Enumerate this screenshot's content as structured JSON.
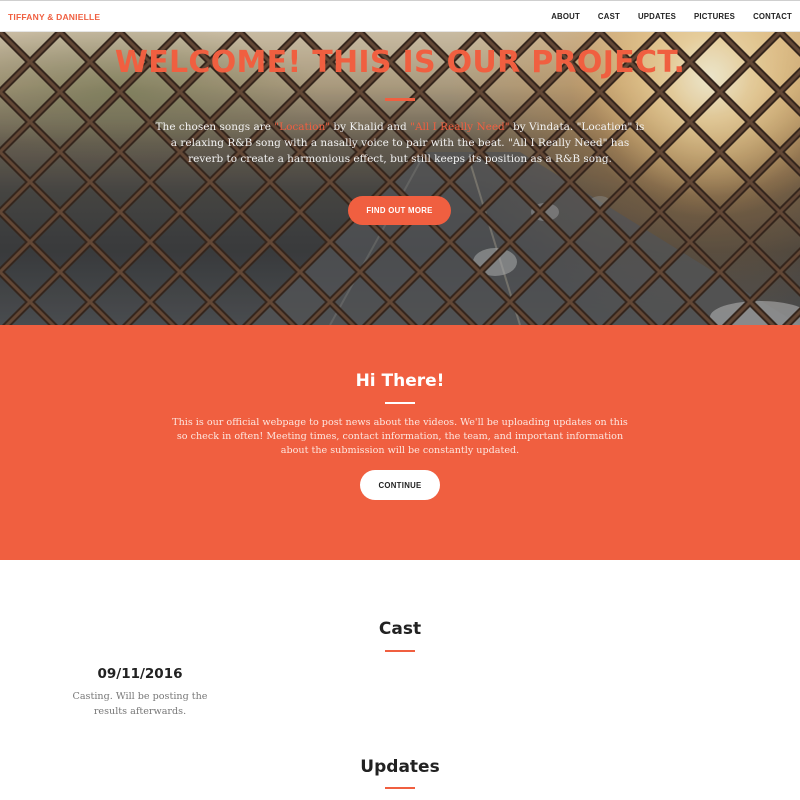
{
  "nav": {
    "brand": "TIFFANY & DANIELLE",
    "links": [
      "ABOUT",
      "CAST",
      "UPDATES",
      "PICTURES",
      "CONTACT"
    ]
  },
  "hero": {
    "title": "WELCOME! THIS IS OUR PROJECT.",
    "text_part1": "The chosen songs are ",
    "song1": "\"Location\"",
    "text_part2": "  by Khalid and ",
    "song2": "\"All I Really Need\"",
    "text_part3": " by Vindata. \"Location\" is a relaxing R&B song with a nasally voice to pair with the beat. \"All I Really Need\" has reverb to create a harmonious effect, but still keeps its position as a R&B song.",
    "button_label": "FIND OUT MORE"
  },
  "about": {
    "title": "Hi There!",
    "text": "This is our official webpage to post news about the videos. We'll be uploading updates on this so check in often! Meeting times, contact information, the team, and important information about the submission will be constantly updated.",
    "button_label": "CONTINUE"
  },
  "cast": {
    "title": "Cast",
    "entries": [
      {
        "date": "09/11/2016",
        "description": "Casting. Will be posting the results afterwards."
      }
    ]
  },
  "updates": {
    "title": "Updates"
  },
  "colors": {
    "accent": "#f05f40",
    "section_bg": "#f05f40",
    "text_dark": "#222222",
    "text_muted": "#777777"
  }
}
